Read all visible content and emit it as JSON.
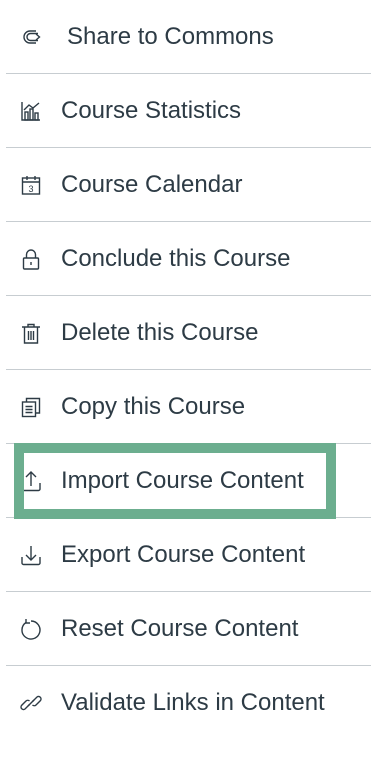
{
  "menu": {
    "items": [
      {
        "label": "Share to Commons",
        "icon": "share-icon"
      },
      {
        "label": "Course Statistics",
        "icon": "statistics-icon"
      },
      {
        "label": "Course Calendar",
        "icon": "calendar-icon"
      },
      {
        "label": "Conclude this Course",
        "icon": "lock-icon"
      },
      {
        "label": "Delete this Course",
        "icon": "trash-icon"
      },
      {
        "label": "Copy this Course",
        "icon": "copy-icon"
      },
      {
        "label": "Import Course Content",
        "icon": "upload-icon"
      },
      {
        "label": "Export Course Content",
        "icon": "download-icon"
      },
      {
        "label": "Reset Course Content",
        "icon": "reset-icon"
      },
      {
        "label": "Validate Links in Content",
        "icon": "link-icon"
      }
    ],
    "calendar_day": "3",
    "highlighted_item": "Import Course Content",
    "highlight_color": "#6cae8f",
    "text_color": "#2d3b45",
    "divider_color": "#c7cdd1"
  }
}
